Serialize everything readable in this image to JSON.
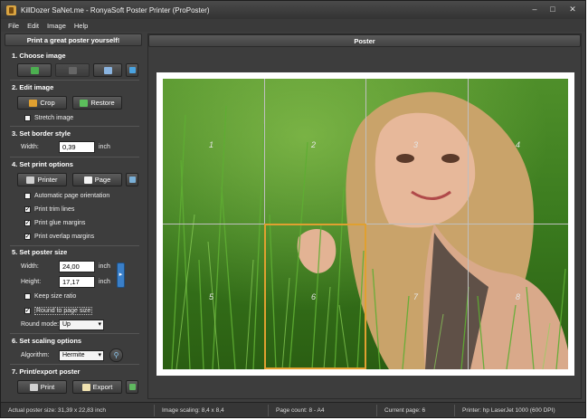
{
  "window": {
    "title": "KillDozer SaNet.me - RonyaSoft Poster Printer (ProPoster)",
    "close_glyph": "✕",
    "min_glyph": "–",
    "max_glyph": "□"
  },
  "menu": [
    "File",
    "Edit",
    "Image",
    "Help"
  ],
  "left_panel": {
    "header": "Print a great poster yourself!",
    "sections": {
      "choose_image": "1. Choose image",
      "edit_image": "2. Edit image",
      "border_style": "3. Set border style",
      "print_options": "4. Set print options",
      "poster_size": "5. Set poster size",
      "scaling": "6. Set scaling options",
      "print_export": "7. Print/export poster"
    },
    "edit": {
      "crop": "Crop",
      "restore": "Restore",
      "stretch": "Stretch image",
      "stretch_checked": false
    },
    "border": {
      "width_label": "Width:",
      "width_value": "0,39",
      "unit": "inch"
    },
    "print": {
      "printer": "Printer",
      "page": "Page",
      "options": [
        {
          "label": "Automatic page orientation",
          "checked": false
        },
        {
          "label": "Print trim lines",
          "checked": true
        },
        {
          "label": "Print glue margins",
          "checked": true
        },
        {
          "label": "Print overlap margins",
          "checked": true
        }
      ]
    },
    "size": {
      "width_label": "Width:",
      "width_value": "24,00",
      "height_label": "Height:",
      "height_value": "17,17",
      "unit": "inch",
      "keep_ratio": "Keep size ratio",
      "keep_ratio_checked": false,
      "round": "Round to page size",
      "round_checked": true,
      "round_mode_label": "Round mode:",
      "round_mode_value": "Up"
    },
    "scaling": {
      "algorithm_label": "Algorithm:",
      "algorithm_value": "Hermite"
    },
    "export": {
      "print": "Print",
      "export": "Export"
    }
  },
  "poster_panel": {
    "header": "Poster",
    "pages": [
      "1",
      "2",
      "3",
      "4",
      "5",
      "6",
      "7",
      "8"
    ],
    "current_page": 6
  },
  "status": {
    "actual_size": "Actual poster size: 31,39 x 22,83 inch",
    "scaling": "Image scaling: 8,4 x 8,4",
    "page_count": "Page count: 8 - A4",
    "current_page": "Current page: 6",
    "printer": "Printer: hp LaserJet 1000 (600 DPI)"
  },
  "colors": {
    "accent": "#e0a030",
    "panel": "#3d3d3d",
    "grass": "#2d6b17"
  }
}
